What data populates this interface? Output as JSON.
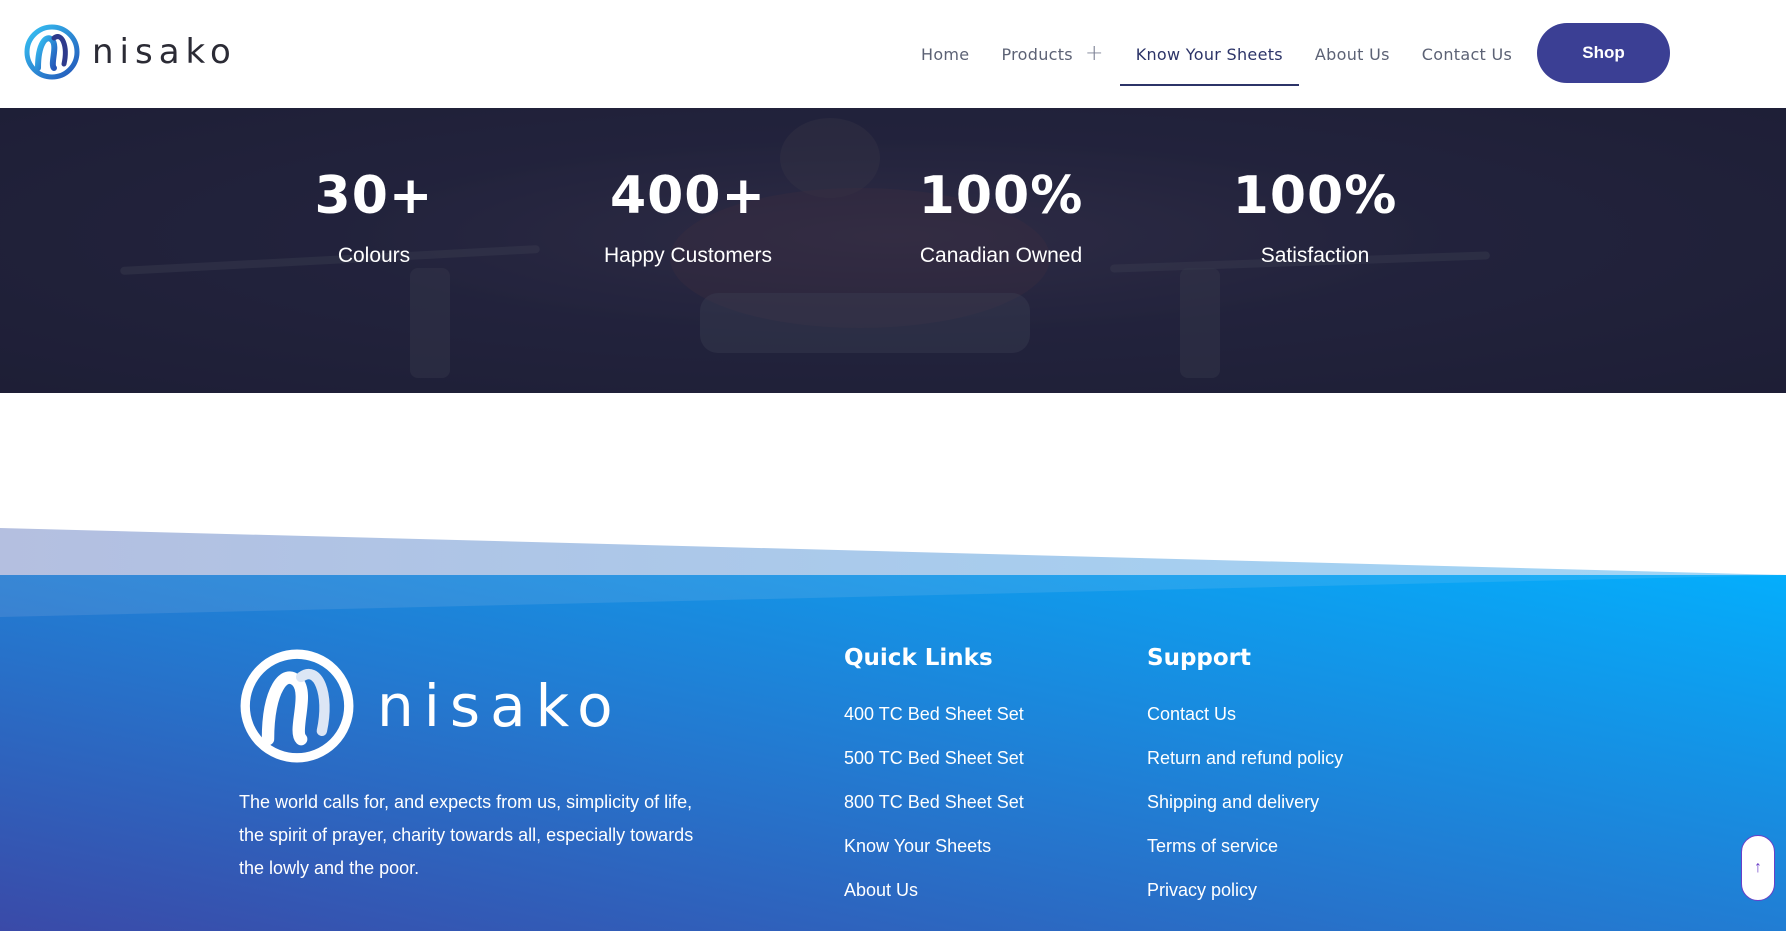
{
  "brand": {
    "name": "nisako"
  },
  "nav": {
    "items": [
      {
        "label": "Home"
      },
      {
        "label": "Products"
      },
      {
        "label": "Know Your Sheets"
      },
      {
        "label": "About Us"
      },
      {
        "label": "Contact Us"
      }
    ],
    "shop_label": "Shop"
  },
  "stats": [
    {
      "value": "30+",
      "label": "Colours"
    },
    {
      "value": "400+",
      "label": "Happy Customers"
    },
    {
      "value": "100%",
      "label": "Canadian Owned"
    },
    {
      "value": "100%",
      "label": "Satisfaction"
    }
  ],
  "footer": {
    "tagline": "The world calls for, and expects from us, simplicity of life, the spirit of prayer, charity towards all, especially towards the lowly and the poor.",
    "quick_links": {
      "title": "Quick Links",
      "items": [
        "400 TC Bed Sheet Set",
        "500 TC Bed Sheet Set",
        "800 TC Bed Sheet Set",
        "Know Your Sheets",
        "About Us"
      ]
    },
    "support": {
      "title": "Support",
      "items": [
        "Contact Us",
        "Return and refund policy",
        "Shipping and delivery",
        "Terms of service",
        "Privacy policy"
      ]
    }
  },
  "colors": {
    "primary": "#3b3f94",
    "nav_active": "#2c3468",
    "stats_bg": "#22233c",
    "footer_start": "#3a4aa8",
    "footer_end": "#04aefc"
  },
  "icons": {
    "scroll_top": "arrow-up-icon",
    "products_toggle": "plus-icon"
  }
}
